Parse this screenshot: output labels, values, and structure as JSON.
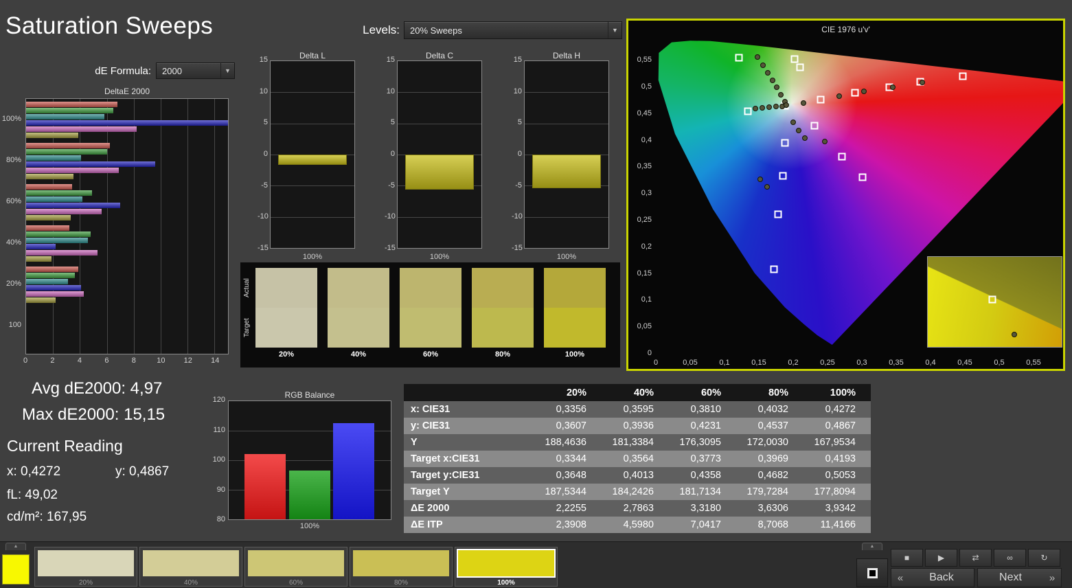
{
  "page": {
    "title": "Saturation Sweeps"
  },
  "controls": {
    "levels_label": "Levels:",
    "levels_value": "20% Sweeps",
    "de_formula_label": "dE Formula:",
    "de_formula_value": "2000"
  },
  "readings": {
    "avg": "Avg dE2000: 4,97",
    "max": "Max dE2000: 15,15",
    "heading": "Current Reading",
    "x": "x: 0,4272",
    "y": "y: 0,4867",
    "fl": "fL: 49,02",
    "cd": "cd/m²: 167,95"
  },
  "chart_data": [
    {
      "id": "deltae2000",
      "type": "bar",
      "orientation": "horizontal",
      "title": "DeltaE 2000",
      "categories": [
        "100%",
        "80%",
        "60%",
        "40%",
        "20%",
        "100"
      ],
      "series": [
        {
          "name": "Red",
          "color": "#cf5a50",
          "values": [
            6.8,
            6.2,
            3.4,
            3.2,
            3.9,
            0
          ]
        },
        {
          "name": "Green",
          "color": "#3f9f3f",
          "values": [
            6.5,
            6.0,
            4.9,
            4.8,
            3.6,
            0
          ]
        },
        {
          "name": "Cyan",
          "color": "#2f8f8f",
          "values": [
            5.8,
            4.1,
            4.2,
            4.6,
            3.1,
            0
          ]
        },
        {
          "name": "Blue",
          "color": "#2424c0",
          "values": [
            15.15,
            9.6,
            7.0,
            2.2,
            4.1,
            0
          ]
        },
        {
          "name": "Magenta",
          "color": "#cf6ac0",
          "values": [
            8.2,
            6.9,
            5.6,
            5.3,
            4.3,
            0
          ]
        },
        {
          "name": "Yellow",
          "color": "#a8a040",
          "values": [
            3.9,
            3.5,
            3.3,
            1.9,
            2.2,
            0
          ]
        }
      ],
      "xmax": 15,
      "ticks": [
        0,
        2,
        4,
        6,
        8,
        10,
        12,
        14
      ]
    },
    {
      "id": "delta_l",
      "type": "bar",
      "title": "Delta L",
      "categories": [
        "100%"
      ],
      "values": [
        -1.7
      ],
      "ylim": [
        -15,
        15
      ],
      "yticks": [
        15,
        10,
        5,
        0,
        -5,
        -10,
        -15
      ],
      "xlabel": "100%"
    },
    {
      "id": "delta_c",
      "type": "bar",
      "title": "Delta C",
      "categories": [
        "100%"
      ],
      "values": [
        -5.6
      ],
      "ylim": [
        -15,
        15
      ],
      "yticks": [
        15,
        10,
        5,
        0,
        -5,
        -10,
        -15
      ],
      "xlabel": "100%"
    },
    {
      "id": "delta_h",
      "type": "bar",
      "title": "Delta H",
      "categories": [
        "100%"
      ],
      "values": [
        -5.4
      ],
      "ylim": [
        -15,
        15
      ],
      "yticks": [
        15,
        10,
        5,
        0,
        -5,
        -10,
        -15
      ],
      "xlabel": "100%"
    },
    {
      "id": "rgb_balance",
      "type": "bar",
      "title": "RGB Balance",
      "categories": [
        "Red",
        "Green",
        "Blue"
      ],
      "values": [
        102,
        96.5,
        112.5
      ],
      "colors": [
        "#f01818",
        "#18a018",
        "#1818f0"
      ],
      "ylim": [
        80,
        120
      ],
      "yticks": [
        120,
        110,
        100,
        90,
        80
      ],
      "xlabel": "100%"
    },
    {
      "id": "cie_diagram",
      "type": "scatter",
      "title": "CIE 1976 u'v'",
      "xlim": [
        0,
        0.55
      ],
      "ylim": [
        0,
        0.55
      ],
      "xticks": [
        "0",
        "0,05",
        "0,1",
        "0,15",
        "0,2",
        "0,25",
        "0,3",
        "0,35",
        "0,4",
        "0,45",
        "0,5",
        "0,55"
      ],
      "xtick_values": [
        0,
        0.05,
        0.1,
        0.15,
        0.2,
        0.25,
        0.3,
        0.35,
        0.4,
        0.45,
        0.5,
        0.55
      ],
      "yticks": [
        "0",
        "0,05",
        "0,1",
        "0,15",
        "0,2",
        "0,25",
        "0,3",
        "0,35",
        "0,4",
        "0,45",
        "0,5",
        "0,55"
      ],
      "ytick_values": [
        0,
        0.05,
        0.1,
        0.15,
        0.2,
        0.25,
        0.3,
        0.35,
        0.4,
        0.45,
        0.5,
        0.55
      ],
      "targets": [
        [
          0.121,
          0.555
        ],
        [
          0.202,
          0.553
        ],
        [
          0.21,
          0.537
        ],
        [
          0.447,
          0.52
        ],
        [
          0.385,
          0.51
        ],
        [
          0.34,
          0.5
        ],
        [
          0.29,
          0.489
        ],
        [
          0.24,
          0.476
        ],
        [
          0.134,
          0.455
        ],
        [
          0.188,
          0.465
        ],
        [
          0.231,
          0.427
        ],
        [
          0.188,
          0.395
        ],
        [
          0.271,
          0.369
        ],
        [
          0.185,
          0.333
        ],
        [
          0.301,
          0.331
        ],
        [
          0.178,
          0.262
        ],
        [
          0.172,
          0.159
        ]
      ],
      "measurements": [
        [
          0.148,
          0.556
        ],
        [
          0.156,
          0.541
        ],
        [
          0.163,
          0.527
        ],
        [
          0.17,
          0.513
        ],
        [
          0.176,
          0.499
        ],
        [
          0.182,
          0.486
        ],
        [
          0.188,
          0.473
        ],
        [
          0.145,
          0.46
        ],
        [
          0.155,
          0.461
        ],
        [
          0.165,
          0.462
        ],
        [
          0.175,
          0.463
        ],
        [
          0.184,
          0.464
        ],
        [
          0.215,
          0.47
        ],
        [
          0.267,
          0.483
        ],
        [
          0.303,
          0.492
        ],
        [
          0.345,
          0.499
        ],
        [
          0.388,
          0.508
        ],
        [
          0.2,
          0.434
        ],
        [
          0.208,
          0.419
        ],
        [
          0.217,
          0.404
        ],
        [
          0.246,
          0.398
        ],
        [
          0.152,
          0.327
        ],
        [
          0.162,
          0.313
        ],
        [
          0.19,
          0.466
        ]
      ],
      "inset": {
        "square": [
          0.48,
          0.47
        ],
        "circle": [
          0.645,
          0.865
        ]
      }
    }
  ],
  "swatch_comparison": {
    "row_labels": [
      "Actual",
      "Target"
    ],
    "columns": [
      {
        "label": "20%",
        "actual": "#c6c2a6",
        "target": "#cac7ac"
      },
      {
        "label": "40%",
        "actual": "#c2bc8a",
        "target": "#c4c08e"
      },
      {
        "label": "60%",
        "actual": "#bdb56e",
        "target": "#c0bc70"
      },
      {
        "label": "80%",
        "actual": "#b9ad52",
        "target": "#bdb94e"
      },
      {
        "label": "100%",
        "actual": "#b4a83a",
        "target": "#c1b92c"
      }
    ]
  },
  "table": {
    "headers": [
      "",
      "20%",
      "40%",
      "60%",
      "80%",
      "100%"
    ],
    "rows": [
      {
        "label": "x: CIE31",
        "values": [
          "0,3356",
          "0,3595",
          "0,3810",
          "0,4032",
          "0,4272"
        ]
      },
      {
        "label": "y: CIE31",
        "values": [
          "0,3607",
          "0,3936",
          "0,4231",
          "0,4537",
          "0,4867"
        ]
      },
      {
        "label": "Y",
        "values": [
          "188,4636",
          "181,3384",
          "176,3095",
          "172,0030",
          "167,9534"
        ]
      },
      {
        "label": "Target x:CIE31",
        "values": [
          "0,3344",
          "0,3564",
          "0,3773",
          "0,3969",
          "0,4193"
        ]
      },
      {
        "label": "Target y:CIE31",
        "values": [
          "0,3648",
          "0,4013",
          "0,4358",
          "0,4682",
          "0,5053"
        ]
      },
      {
        "label": "Target Y",
        "values": [
          "187,5344",
          "184,2426",
          "181,7134",
          "179,7284",
          "177,8094"
        ]
      },
      {
        "label": "ΔE 2000",
        "values": [
          "2,2255",
          "2,7863",
          "3,3180",
          "3,6306",
          "3,9342"
        ]
      },
      {
        "label": "ΔE ITP",
        "values": [
          "2,3908",
          "4,5980",
          "7,0417",
          "8,7068",
          "11,4166"
        ]
      }
    ]
  },
  "bottom_bar": {
    "current_color": "#f8f800",
    "patches": [
      {
        "label": "20%",
        "color": "#d9d6b8",
        "selected": false
      },
      {
        "label": "40%",
        "color": "#d3cd97",
        "selected": false
      },
      {
        "label": "60%",
        "color": "#cdc675",
        "selected": false
      },
      {
        "label": "80%",
        "color": "#cabf55",
        "selected": false
      },
      {
        "label": "100%",
        "color": "#ddd414",
        "selected": true
      }
    ],
    "transport": [
      {
        "name": "stop",
        "glyph": "■"
      },
      {
        "name": "play",
        "glyph": "▶"
      },
      {
        "name": "step",
        "glyph": "⇄"
      },
      {
        "name": "loop",
        "glyph": "∞"
      },
      {
        "name": "refresh",
        "glyph": "↻"
      }
    ],
    "back_label": "Back",
    "next_label": "Next",
    "back_arrow": "«",
    "next_arrow": "»"
  }
}
